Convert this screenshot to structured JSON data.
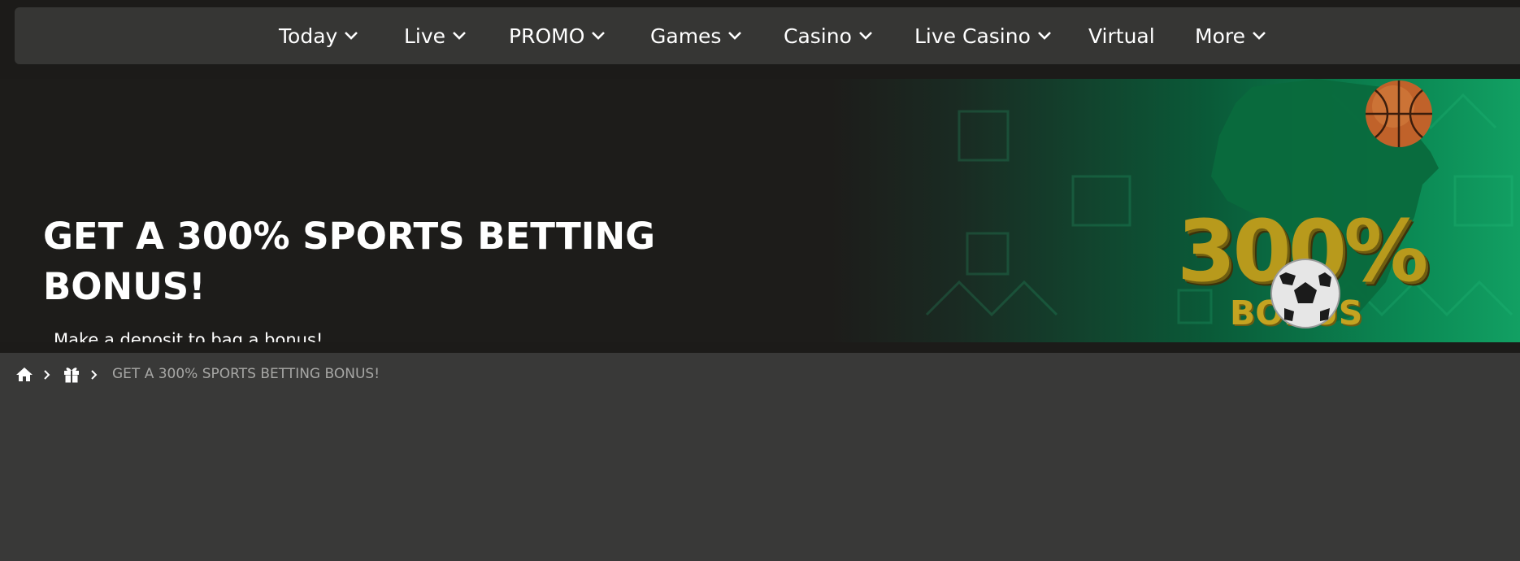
{
  "nav": {
    "items": [
      {
        "label": "Today",
        "has_dropdown": true
      },
      {
        "label": "Live",
        "has_dropdown": true
      },
      {
        "label": "PROMO",
        "has_dropdown": true
      },
      {
        "label": "Games",
        "has_dropdown": true
      },
      {
        "label": "Casino",
        "has_dropdown": true
      },
      {
        "label": "Live Casino",
        "has_dropdown": true
      },
      {
        "label": "Virtual",
        "has_dropdown": false
      },
      {
        "label": "More",
        "has_dropdown": true
      }
    ],
    "dropdown_icon": "chevron-down-icon"
  },
  "hero": {
    "title": "GET A 300% SPORTS BETTING BONUS!",
    "subtitle": "Make a deposit to bag a bonus!",
    "banner_percent": "300%",
    "banner_word": "BONUS",
    "accent_green": "#0b8b55",
    "accent_gold": "#c4a321"
  },
  "breadcrumb": {
    "home_icon": "home-icon",
    "promo_icon": "gift-icon",
    "separator_icon": "chevron-right-icon",
    "current": "GET A 300% SPORTS BETTING BONUS!"
  }
}
